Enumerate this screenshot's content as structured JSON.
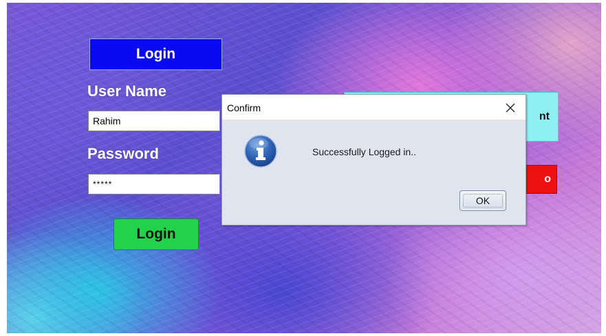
{
  "login_window": {
    "header_label": "Login",
    "username_label": "User Name",
    "username_value": "Rahim",
    "password_label": "Password",
    "password_value": "*****",
    "login_button_label": "Login",
    "cyan_button_partial_label": "nt",
    "red_button_partial_label": "o"
  },
  "dialog": {
    "title": "Confirm",
    "close_icon": "close-icon",
    "icon": "info-icon",
    "message": "Successfully Logged in..",
    "ok_label": "OK"
  },
  "colors": {
    "header_blue": "#0a0af0",
    "login_green": "#22d24a",
    "cyan_button": "#8ff0f2",
    "red_button": "#ee1111",
    "dialog_bg": "#dfe4ee"
  }
}
